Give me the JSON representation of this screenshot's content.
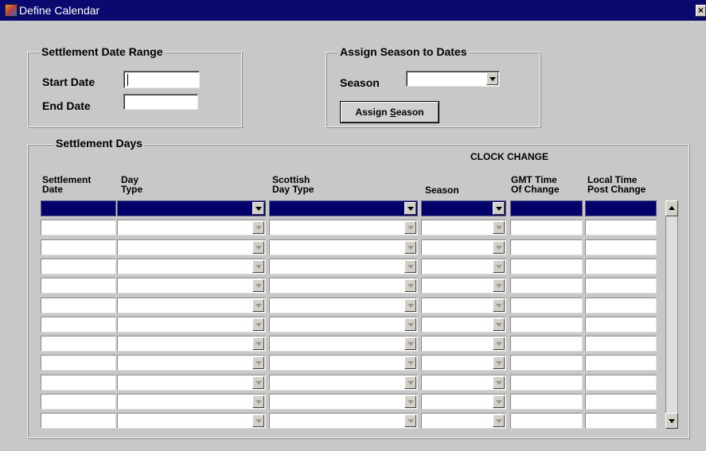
{
  "window": {
    "title": "Define Calendar",
    "close_glyph": "×"
  },
  "range": {
    "title": "Settlement Date Range",
    "start_label": "Start Date",
    "end_label": "End Date",
    "start_value": "",
    "end_value": ""
  },
  "assign": {
    "title": "Assign Season to Dates",
    "season_label": "Season",
    "season_value": "",
    "button_prefix": "Assign ",
    "button_mnemonic": "S",
    "button_suffix": "eason"
  },
  "days": {
    "title": "Settlement Days",
    "clock_change": "CLOCK CHANGE",
    "columns": {
      "settlement_date": [
        "Settlement",
        "Date"
      ],
      "day_type": [
        "Day",
        "Type"
      ],
      "scottish_day_type": [
        "Scottish",
        "Day Type"
      ],
      "season": "Season",
      "gmt_time": [
        "GMT Time",
        "Of Change"
      ],
      "local_time": [
        "Local Time",
        "Post Change"
      ]
    },
    "row_count": 12,
    "selected_row": 0,
    "rows": [
      [
        "",
        "",
        "",
        "",
        "",
        ""
      ],
      [
        "",
        "",
        "",
        "",
        "",
        ""
      ],
      [
        "",
        "",
        "",
        "",
        "",
        ""
      ],
      [
        "",
        "",
        "",
        "",
        "",
        ""
      ],
      [
        "",
        "",
        "",
        "",
        "",
        ""
      ],
      [
        "",
        "",
        "",
        "",
        "",
        ""
      ],
      [
        "",
        "",
        "",
        "",
        "",
        ""
      ],
      [
        "",
        "",
        "",
        "",
        "",
        ""
      ],
      [
        "",
        "",
        "",
        "",
        "",
        ""
      ],
      [
        "",
        "",
        "",
        "",
        "",
        ""
      ],
      [
        "",
        "",
        "",
        "",
        "",
        ""
      ],
      [
        "",
        "",
        "",
        "",
        "",
        ""
      ]
    ]
  },
  "colors": {
    "title_bar": "#0a0a6e",
    "selected_row": "#02026a",
    "background": "#c8c8c8"
  },
  "icons": {
    "window": "calendar-app-icon",
    "combo": "chevron-down-icon",
    "scroll_up": "scroll-up-icon",
    "scroll_down": "scroll-down-icon"
  }
}
